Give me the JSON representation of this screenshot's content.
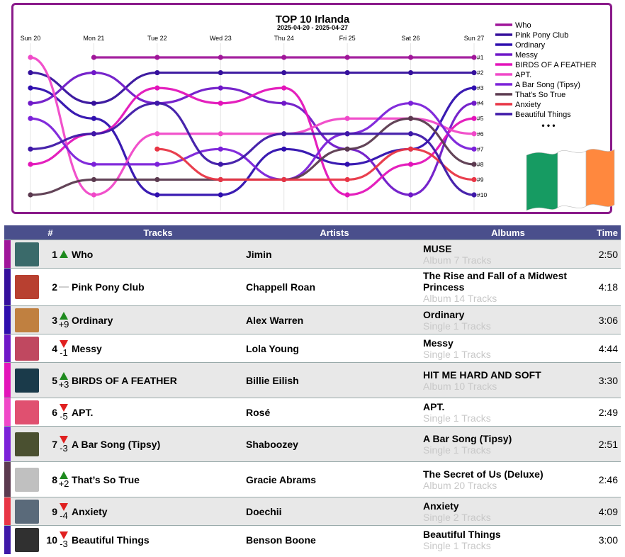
{
  "chart_data": {
    "type": "line",
    "title": "TOP 10 Irlanda",
    "subtitle": "2025-04-20 - 2025-04-27",
    "x": [
      "Sun 20",
      "Mon 21",
      "Tue 22",
      "Wed 23",
      "Thu 24",
      "Fri 25",
      "Sat 26",
      "Sun 27"
    ],
    "rank_labels": [
      "#1",
      "#2",
      "#3",
      "#4",
      "#5",
      "#6",
      "#7",
      "#8",
      "#9",
      "#10"
    ],
    "y_axis": "rank",
    "ylim": [
      1,
      10
    ],
    "legend_more": "• • •",
    "legend_position": "right",
    "series": [
      {
        "name": "Who",
        "color": "#a0169a",
        "ranks": [
          null,
          1,
          1,
          1,
          1,
          1,
          1,
          1
        ]
      },
      {
        "name": "Pink Pony Club",
        "color": "#35109c",
        "ranks": [
          2,
          4,
          2,
          2,
          2,
          2,
          2,
          2
        ]
      },
      {
        "name": "Ordinary",
        "color": "#2f0fae",
        "ranks": [
          3,
          5,
          10,
          10,
          7,
          8,
          7,
          3
        ]
      },
      {
        "name": "Messy",
        "color": "#6f18c8",
        "ranks": [
          4,
          2,
          4,
          3,
          4,
          7,
          10,
          4
        ]
      },
      {
        "name": "BIRDS OF A FEATHER",
        "color": "#e314b9",
        "ranks": [
          8,
          6,
          3,
          4,
          3,
          10,
          8,
          5
        ]
      },
      {
        "name": "APT.",
        "color": "#f048c8",
        "ranks": [
          1,
          10,
          6,
          6,
          6,
          5,
          5,
          6
        ]
      },
      {
        "name": "A Bar Song (Tipsy)",
        "color": "#7b21d9",
        "ranks": [
          5,
          8,
          8,
          7,
          9,
          6,
          4,
          7
        ]
      },
      {
        "name": "That's So True",
        "color": "#5b3a4f",
        "ranks": [
          10,
          9,
          9,
          9,
          9,
          7,
          5,
          8
        ]
      },
      {
        "name": "Anxiety",
        "color": "#e83545",
        "ranks": [
          null,
          null,
          7,
          9,
          9,
          9,
          7,
          9
        ]
      },
      {
        "name": "Beautiful Things",
        "color": "#3e18a8",
        "ranks": [
          7,
          6,
          4,
          8,
          6,
          6,
          6,
          10
        ]
      }
    ]
  },
  "table": {
    "headers": {
      "num": "#",
      "tracks": "Tracks",
      "artists": "Artists",
      "albums": "Albums",
      "time": "Time"
    },
    "rows": [
      {
        "rank": "1",
        "move": "up",
        "delta": "",
        "track": "Who",
        "artist": "Jimin",
        "album": "MUSE",
        "album_sub": "Album 7 Tracks",
        "time": "2:50",
        "color": "#a0169a"
      },
      {
        "rank": "2",
        "move": "same",
        "delta": "",
        "track": "Pink Pony Club",
        "artist": "Chappell Roan",
        "album": "The Rise and Fall of a Midwest Princess",
        "album_sub": "Album 14 Tracks",
        "time": "4:18",
        "color": "#35109c"
      },
      {
        "rank": "3",
        "move": "up",
        "delta": "+9",
        "track": "Ordinary",
        "artist": "Alex Warren",
        "album": "Ordinary",
        "album_sub": "Single 1 Tracks",
        "time": "3:06",
        "color": "#2f0fae"
      },
      {
        "rank": "4",
        "move": "down",
        "delta": "-1",
        "track": "Messy",
        "artist": "Lola Young",
        "album": "Messy",
        "album_sub": "Single 1 Tracks",
        "time": "4:44",
        "color": "#6f18c8"
      },
      {
        "rank": "5",
        "move": "up",
        "delta": "+3",
        "track": "BIRDS OF A FEATHER",
        "artist": "Billie Eilish",
        "album": "HIT ME HARD AND SOFT",
        "album_sub": "Album 10 Tracks",
        "time": "3:30",
        "color": "#e314b9"
      },
      {
        "rank": "6",
        "move": "down",
        "delta": "-5",
        "track": "APT.",
        "artist": "Rosé",
        "album": "APT.",
        "album_sub": "Single 1 Tracks",
        "time": "2:49",
        "color": "#f048c8"
      },
      {
        "rank": "7",
        "move": "down",
        "delta": "-3",
        "track": "A Bar Song (Tipsy)",
        "artist": "Shaboozey",
        "album": "A Bar Song (Tipsy)",
        "album_sub": "Single 1 Tracks",
        "time": "2:51",
        "color": "#7b21d9"
      },
      {
        "rank": "8",
        "move": "up",
        "delta": "+2",
        "track": "That’s So True",
        "artist": "Gracie Abrams",
        "album": "The Secret of Us (Deluxe)",
        "album_sub": "Album 20 Tracks",
        "time": "2:46",
        "color": "#5b3a4f"
      },
      {
        "rank": "9",
        "move": "down",
        "delta": "-4",
        "track": "Anxiety",
        "artist": "Doechii",
        "album": "Anxiety",
        "album_sub": "Single 2 Tracks",
        "time": "4:09",
        "color": "#e83545"
      },
      {
        "rank": "10",
        "move": "down",
        "delta": "-3",
        "track": "Beautiful Things",
        "artist": "Benson Boone",
        "album": "Beautiful Things",
        "album_sub": "Single 1 Tracks",
        "time": "3:00",
        "color": "#3e18a8"
      }
    ],
    "cover_colors": [
      "#3a6a6a",
      "#b84030",
      "#c08040",
      "#c04860",
      "#1a3a4a",
      "#e05070",
      "#4a5030",
      "#c0c0c0",
      "#5a6a7a",
      "#303030"
    ]
  },
  "flag_colors": [
    "#169b62",
    "#ffffff",
    "#ff883e"
  ]
}
